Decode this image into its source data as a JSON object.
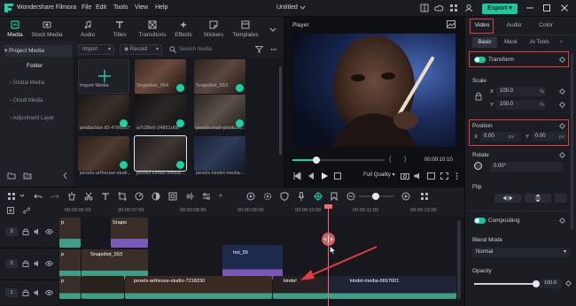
{
  "app": {
    "name": "Wondershare Filmora",
    "menus": [
      "File",
      "Edit",
      "Tools",
      "View",
      "Help"
    ],
    "doc_title": "Untitled",
    "export_label": "Export"
  },
  "toolbar": {
    "tabs": [
      "Media",
      "Stock Media",
      "Audio",
      "Titles",
      "Transitions",
      "Effects",
      "Stickers",
      "Templates"
    ]
  },
  "sidebar": {
    "project_media": "Project Media",
    "folder": "Folder",
    "items": [
      "Global Media",
      "Cloud Media",
      "Adjustment Layer"
    ]
  },
  "mediabar": {
    "import_label": "Import",
    "record_label": "Record",
    "search_placeholder": "Search media"
  },
  "media": {
    "items": [
      "Import Media",
      "Snapshot_554",
      "Snapshot_553",
      "production ID-4786157",
      "a7c28e0-24851d08",
      "pexels-mart-producti...",
      "pexels-artheuse-studi...",
      "pexels-kindel-media-...",
      "pexels-kindel-media-..."
    ]
  },
  "player": {
    "label": "Player",
    "timecode": "00:00:10:10",
    "quality": "Full Quality",
    "progress": 0.26
  },
  "rpanel": {
    "tabs": [
      "Video",
      "Audio",
      "Color"
    ],
    "subtabs": [
      "Basic",
      "Mask",
      "AI Tools"
    ],
    "transform": "Transform",
    "scale": "Scale",
    "scale_x_label": "X",
    "scale_x": "100.0",
    "scale_y_label": "Y",
    "scale_y": "100.0",
    "scale_unit": "%",
    "position": "Position",
    "pos_x_label": "X",
    "pos_x": "0.00",
    "pos_y_label": "Y",
    "pos_y": "0.00",
    "pos_unit": "px",
    "rotate": "Rotate",
    "rotate_value": "0.00°",
    "flip": "Flip",
    "compositing": "Compositing",
    "blend_mode_label": "Blend Mode",
    "blend_mode": "Normal",
    "opacity": "Opacity",
    "opacity_value": "100.0",
    "opacity_level": 1.0
  },
  "timeline": {
    "ruler": [
      "00:00:06:00",
      "00:00:07:00",
      "00:00:08:00",
      "00:00:09:00",
      "00:00:10:00",
      "00:00:11:00",
      "00:00:12:00"
    ],
    "tracks": [
      "3",
      "2",
      "1"
    ],
    "clips_t3": [
      "p",
      "Snaps"
    ],
    "clips_t2": [
      "p",
      "Snapshot_553",
      "hot_55"
    ],
    "clips_t1": [
      "p",
      "pexels-artheuse-studio-7218230",
      "kindel",
      "kindel-media-6667601"
    ]
  },
  "colors": {
    "accent": "#13d4a5",
    "highlight": "#e23b44",
    "playhead": "#f26b6b"
  }
}
